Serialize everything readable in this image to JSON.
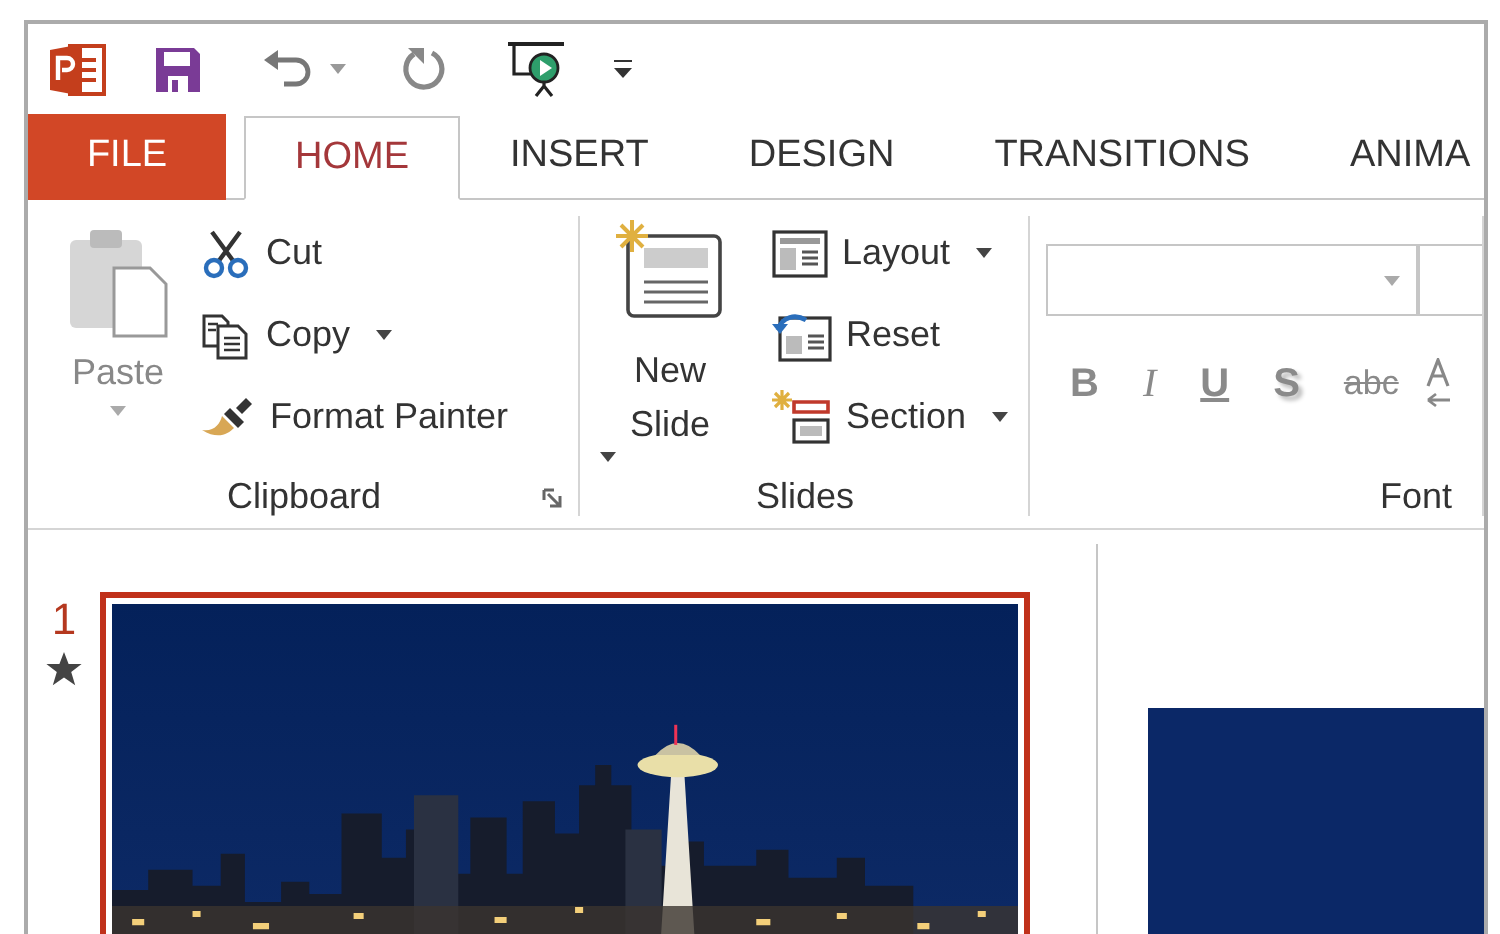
{
  "tabs": [
    {
      "label": "FILE",
      "kind": "file",
      "selected": false
    },
    {
      "label": "HOME",
      "kind": "tab",
      "selected": true
    },
    {
      "label": "INSERT",
      "kind": "tab",
      "selected": false
    },
    {
      "label": "DESIGN",
      "kind": "tab",
      "selected": false
    },
    {
      "label": "TRANSITIONS",
      "kind": "tab",
      "selected": false
    },
    {
      "label": "ANIMA",
      "kind": "tab",
      "selected": false
    }
  ],
  "ribbon": {
    "clipboard": {
      "label": "Clipboard",
      "paste": {
        "label": "Paste",
        "disabled": true
      },
      "commands": [
        {
          "label": "Cut",
          "kind": "cut",
          "dropdown": false
        },
        {
          "label": "Copy",
          "kind": "copy",
          "dropdown": true
        },
        {
          "label": "Format Painter",
          "kind": "format-painter",
          "dropdown": false
        }
      ]
    },
    "slides": {
      "label": "Slides",
      "new_slide": {
        "label": "New Slide",
        "dropdown": true
      },
      "commands": [
        {
          "label": "Layout",
          "kind": "layout",
          "dropdown": true
        },
        {
          "label": "Reset",
          "kind": "reset",
          "dropdown": false
        },
        {
          "label": "Section",
          "kind": "section",
          "dropdown": true
        }
      ]
    },
    "font": {
      "label": "Font",
      "format_buttons": [
        {
          "label": "B",
          "kind": "bold",
          "disabled": true
        },
        {
          "label": "I",
          "kind": "italic",
          "disabled": true
        },
        {
          "label": "U",
          "kind": "underline",
          "disabled": true
        },
        {
          "label": "S",
          "kind": "shadow",
          "disabled": true
        },
        {
          "label": "abc",
          "kind": "strikethrough",
          "disabled": true
        }
      ]
    }
  },
  "slide_pane": {
    "thumbnails": [
      {
        "number": "1",
        "selected": true,
        "animated": true,
        "kind": "picture"
      }
    ]
  }
}
